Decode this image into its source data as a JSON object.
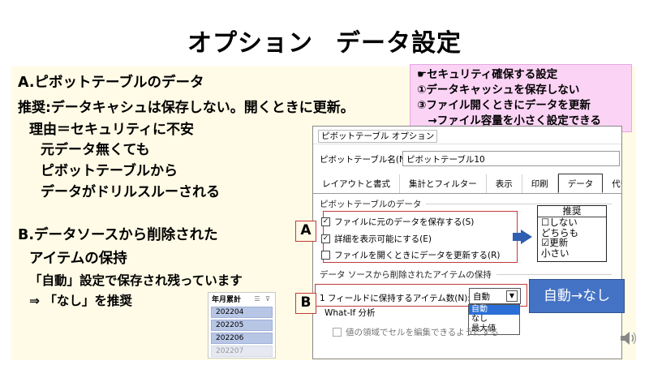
{
  "slide": {
    "title_left": "オプション",
    "title_right": "データ設定"
  },
  "note": {
    "lines": [
      "☛セキュリティ確保する設定",
      "①データキャッシュを保存しない",
      "③ファイル開くときにデータを更新",
      "　→ファイル容量を小さく設定できる"
    ]
  },
  "section_a": {
    "heading": "A.ピボットテーブルのデータ",
    "lines": [
      "推奨:データキャシュは保存しない。開くときに更新。",
      "理由＝セキュリティに不安",
      "元データ無くても",
      "ピボットテーブルから",
      "データがドリルスルーされる"
    ]
  },
  "section_b": {
    "heading": "B.データソースから削除された",
    "lines": [
      "アイテムの保持",
      "「自動」設定で保存され残っています",
      "⇒ 「なし」を推奨"
    ]
  },
  "field_list": {
    "header": "年月累計",
    "items": [
      "202204",
      "202205",
      "202206",
      "202207"
    ]
  },
  "dialog": {
    "title": "ピボットテーブル オプション",
    "name_label": "ピボットテーブル名(N):",
    "name_value": "ピボットテーブル10",
    "tabs": [
      "レイアウトと書式",
      "集計とフィルター",
      "表示",
      "印刷",
      "データ",
      "代替テ"
    ],
    "active_tab": "データ",
    "data_section": "ピボットテーブルのデータ",
    "checkboxes": [
      {
        "label": "ファイルに元のデータを保存する(S)",
        "checked": true
      },
      {
        "label": "詳細を表示可能にする(E)",
        "checked": true
      },
      {
        "label": "ファイルを開くときにデータを更新する(R)",
        "checked": false
      }
    ],
    "deleted_section": "データ ソースから削除されたアイテムの保持",
    "keep_label": "1 フィールドに保持するアイテム数(N):",
    "keep_value": "自動",
    "keep_options": [
      "自動",
      "なし",
      "最大値"
    ],
    "whatif_section": "What-If 分析",
    "whatif_checkbox": "値の領域でセルを編集できるようにする"
  },
  "callouts": {
    "badge_a": "A",
    "badge_b": "B",
    "recommend_header": "推奨",
    "recommend_lines": [
      "☐しない",
      "どちらも",
      "☑更新",
      "小さい"
    ],
    "action_text": "自動→なし"
  },
  "colors": {
    "note_bg": "#fbd3f5",
    "panel_bg": "#fffbe6",
    "action_bg": "#4472c4",
    "highlight_border": "#c23a3a",
    "field_item_bg": "#b8c6e6"
  }
}
